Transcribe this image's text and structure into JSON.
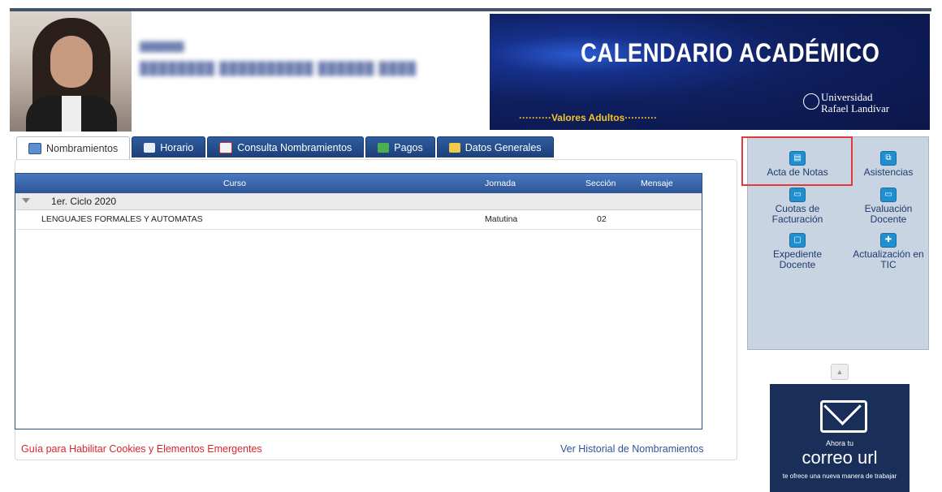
{
  "banner": {
    "title": "CALENDARIO ACADÉMICO",
    "subtitle": "··········Valores Adultos··········",
    "university_line1": "Universidad",
    "university_line2": "Rafael Landívar"
  },
  "tabs": [
    {
      "label": "Nombramientos",
      "icon": "folder-chart-icon",
      "active": true
    },
    {
      "label": "Horario",
      "icon": "calendar-icon"
    },
    {
      "label": "Consulta Nombramientos",
      "icon": "document-search-icon"
    },
    {
      "label": "Pagos",
      "icon": "money-icon"
    },
    {
      "label": "Datos Generales",
      "icon": "folder-icon"
    }
  ],
  "table": {
    "headers": {
      "curso": "Curso",
      "jornada": "Jornada",
      "seccion": "Sección",
      "mensaje": "Mensaje"
    },
    "group": "1er. Ciclo 2020",
    "rows": [
      {
        "curso": "LENGUAJES FORMALES Y AUTOMATAS",
        "jornada": "Matutina",
        "seccion": "02",
        "mensaje": ""
      }
    ]
  },
  "links": {
    "cookies_guide": "Guía para Habilitar Cookies y Elementos Emergentes",
    "history": "Ver Historial de Nombramientos"
  },
  "side_menu": [
    {
      "label": "Acta de Notas",
      "icon": "document-icon",
      "highlighted": true
    },
    {
      "label": "Asistencias",
      "icon": "copy-icon"
    },
    {
      "label": "Cuotas de Facturación",
      "icon": "folder-icon"
    },
    {
      "label": "Evaluación Docente",
      "icon": "folder-icon"
    },
    {
      "label": "Expediente Docente",
      "icon": "chat-icon"
    },
    {
      "label": "Actualización en TIC",
      "icon": "puzzle-icon"
    }
  ],
  "promo": {
    "line1": "Ahora tu",
    "brand": "correo url",
    "line3": "te ofrece una nueva manera de trabajar"
  },
  "colors": {
    "accent": "#2d5597",
    "highlight": "#e03a3a",
    "link_red": "#d9262e",
    "banner_bg": "#0f1f5e",
    "banner_accent": "#f3c52b"
  }
}
